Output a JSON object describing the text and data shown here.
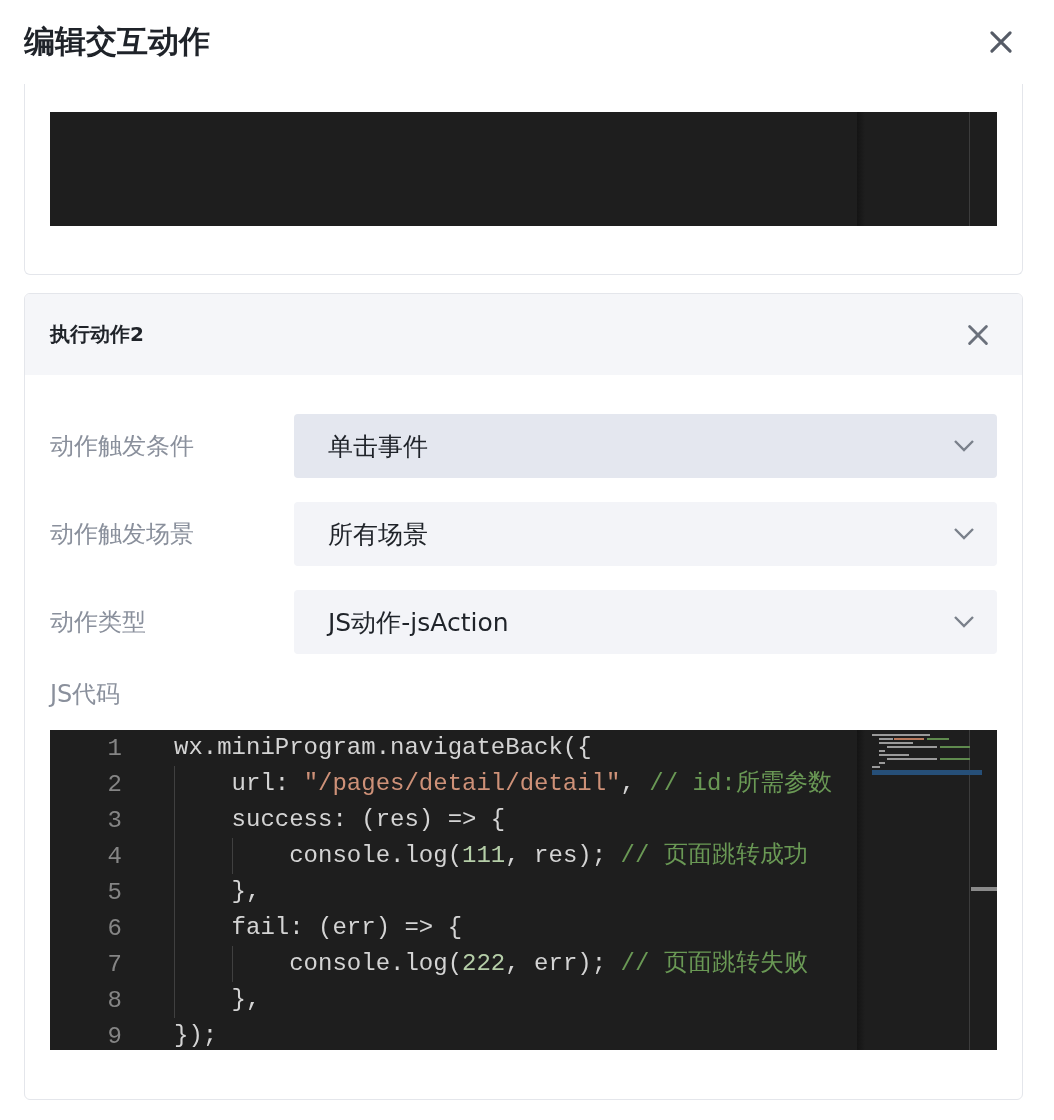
{
  "dialog": {
    "title": "编辑交互动作"
  },
  "previous_action": {
    "editor": {
      "kind": "code-editor"
    }
  },
  "action": {
    "title": "执行动作2",
    "fields": [
      {
        "label": "动作触发条件",
        "value": "单击事件",
        "focused": true
      },
      {
        "label": "动作触发场景",
        "value": "所有场景",
        "focused": false
      },
      {
        "label": "动作类型",
        "value": "JS动作-jsAction",
        "focused": false
      }
    ],
    "code_label": "JS代码",
    "code_lines": [
      {
        "number": "1",
        "tokens": [
          {
            "kind": "plain",
            "text": "wx.miniProgram.navigateBack({"
          }
        ]
      },
      {
        "number": "2",
        "tokens": [
          {
            "kind": "plain",
            "text": "    url: "
          },
          {
            "kind": "string",
            "text": "\"/pages/detail/detail\""
          },
          {
            "kind": "plain",
            "text": ", "
          },
          {
            "kind": "comment",
            "text": "// id:所需参数"
          }
        ]
      },
      {
        "number": "3",
        "tokens": [
          {
            "kind": "plain",
            "text": "    success: (res) => {"
          }
        ]
      },
      {
        "number": "4",
        "tokens": [
          {
            "kind": "plain",
            "text": "        console.log("
          },
          {
            "kind": "number",
            "text": "111"
          },
          {
            "kind": "plain",
            "text": ", res); "
          },
          {
            "kind": "comment",
            "text": "// 页面跳转成功"
          }
        ]
      },
      {
        "number": "5",
        "tokens": [
          {
            "kind": "plain",
            "text": "    },"
          }
        ]
      },
      {
        "number": "6",
        "tokens": [
          {
            "kind": "plain",
            "text": "    fail: (err) => {"
          }
        ]
      },
      {
        "number": "7",
        "tokens": [
          {
            "kind": "plain",
            "text": "        console.log("
          },
          {
            "kind": "number",
            "text": "222"
          },
          {
            "kind": "plain",
            "text": ", err); "
          },
          {
            "kind": "comment",
            "text": "// 页面跳转失败"
          }
        ]
      },
      {
        "number": "8",
        "tokens": [
          {
            "kind": "plain",
            "text": "    },"
          }
        ]
      },
      {
        "number": "9",
        "tokens": [
          {
            "kind": "plain",
            "text": "});"
          }
        ]
      }
    ]
  }
}
